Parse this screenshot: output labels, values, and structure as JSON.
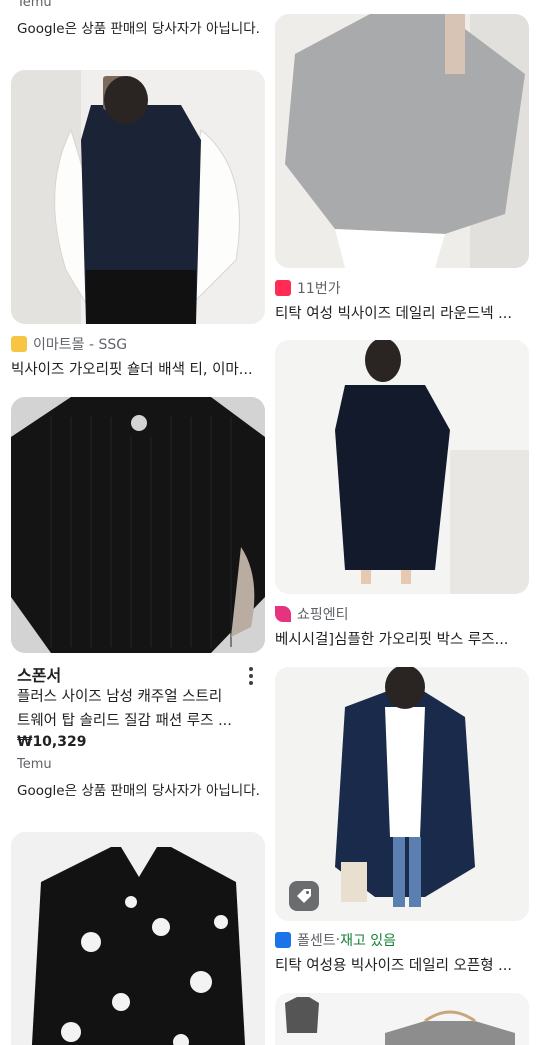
{
  "left": {
    "top_partial": {
      "source": "Temu",
      "note": "Google은 상품 판매의 당사자가 아닙니다."
    },
    "card1": {
      "source": "이마트몰 - SSG",
      "title": "빅사이즈 가오리핏 숄더 배색 티, 이마..."
    },
    "sponsored": {
      "label": "스폰서",
      "title_line1": "플러스 사이즈 남성 캐주얼 스트리",
      "title_line2": "트웨어 탑 솔리드 질감 패션 루즈 ...",
      "price": "₩10,329",
      "source": "Temu",
      "note": "Google은 상품 판매의 당사자가 아닙니다."
    }
  },
  "right": {
    "card1": {
      "source": "11번가",
      "title": "티탁 여성 빅사이즈 데일리 라운드넥 ..."
    },
    "card2": {
      "source": "쇼핑엔티",
      "title": "베시시걸]심플한 가오리핏 박스 루즈..."
    },
    "card3": {
      "source": "폴센트",
      "separator": " · ",
      "stock": "재고 있음",
      "title": "티탁 여성용 빅사이즈 데일리 오픈형 ..."
    }
  },
  "colors": {
    "navy": "#1b2436",
    "black": "#141414",
    "grey_knit": "#a9aaac",
    "cardigan": "#1a2a4a",
    "eleven_red": "#ff2b55",
    "shopping_pink": "#e6337e",
    "pollcent_blue": "#1a73e8",
    "in_stock_green": "#188038"
  },
  "icons": [
    "emart-logo",
    "11st-logo",
    "shoppingnt-logo",
    "pollcent-logo",
    "more-vert-icon",
    "price-tag-icon"
  ]
}
